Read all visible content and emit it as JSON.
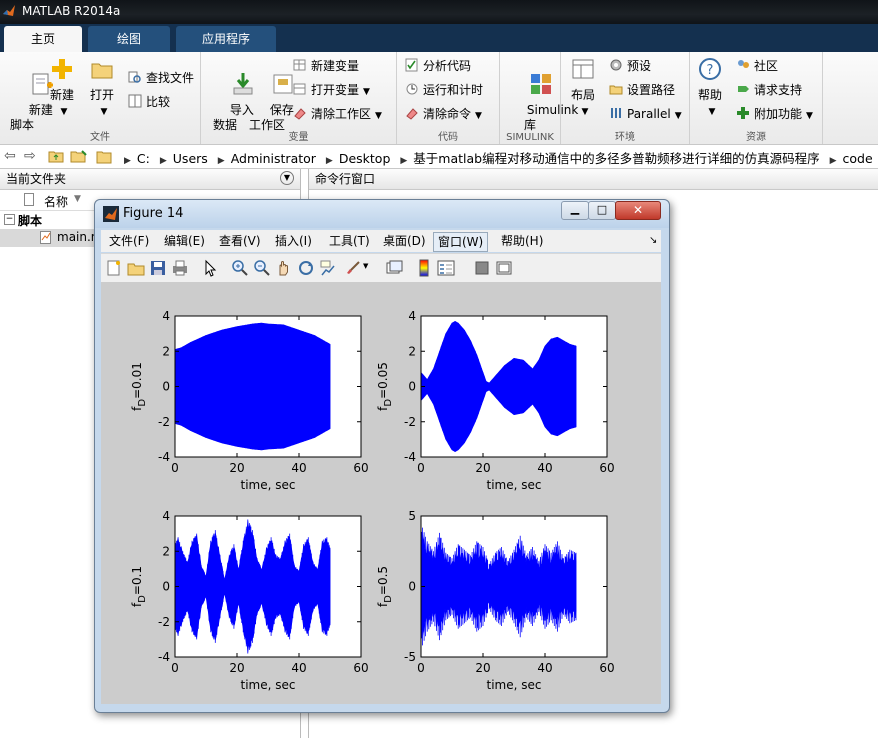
{
  "window": {
    "title": "MATLAB R2014a"
  },
  "ribbon_tabs": [
    {
      "label": "主页",
      "active": true
    },
    {
      "label": "绘图",
      "active": false
    },
    {
      "label": "应用程序",
      "active": false
    }
  ],
  "ribbon": {
    "file": {
      "new_script": "新建\n脚本",
      "new": "新建",
      "open": "打开",
      "find_files": "查找文件",
      "compare": "比较",
      "label": "文件"
    },
    "variable": {
      "import": "导入\n数据",
      "save_ws": "保存\n工作区",
      "new_var": "新建变量",
      "open_var": "打开变量",
      "clear_ws": "清除工作区",
      "label": "变量"
    },
    "code": {
      "analyze": "分析代码",
      "run_time": "运行和计时",
      "clear_cmds": "清除命令",
      "label": "代码"
    },
    "simulink": {
      "lib": "Simulink\n库",
      "label": "SIMULINK"
    },
    "env": {
      "layout": "布局",
      "prefs": "预设",
      "set_path": "设置路径",
      "parallel": "Parallel",
      "label": "环境"
    },
    "resources": {
      "help": "帮助",
      "community": "社区",
      "support": "请求支持",
      "addons": "附加功能",
      "label": "资源"
    }
  },
  "address": {
    "path": [
      "C:",
      "Users",
      "Administrator",
      "Desktop",
      "基于matlab编程对移动通信中的多径多普勒频移进行详细的仿真源码程序",
      "code"
    ]
  },
  "current_folder": {
    "title": "当前文件夹",
    "column": "名称",
    "group": "脚本",
    "file": "main.m"
  },
  "command_window": {
    "title": "命令行窗口"
  },
  "figure": {
    "title": "Figure 14",
    "menu": [
      "文件(F)",
      "编辑(E)",
      "查看(V)",
      "插入(I)",
      "工具(T)",
      "桌面(D)",
      "窗口(W)",
      "帮助(H)"
    ],
    "toolbar_icons": [
      "new-figure-icon",
      "open-file-icon",
      "save-icon",
      "print-icon",
      "select-arrow-icon",
      "zoom-in-icon",
      "zoom-out-icon",
      "pan-hand-icon",
      "rotate-icon",
      "data-cursor-icon",
      "brush-icon",
      "link-plot-icon",
      "colorbar-icon",
      "legend-icon",
      "hide-tools-icon",
      "show-tools-icon"
    ]
  },
  "colors": {
    "signal": "#0000ff",
    "ribbon_blue": "#14304f"
  },
  "chart_data": [
    {
      "type": "area",
      "title": "",
      "xlabel": "time, sec",
      "ylabel": "f_D=0.01",
      "xlim": [
        0,
        60
      ],
      "ylim": [
        -4,
        4
      ],
      "xticks": [
        "0",
        "20",
        "40",
        "60"
      ],
      "yticks": [
        "4",
        "2",
        "0",
        "-2",
        "-4"
      ],
      "series": [
        {
          "x": [
            0,
            2,
            5,
            10,
            15,
            20,
            25,
            28,
            30,
            35,
            40,
            45,
            48,
            50
          ],
          "upper": [
            2.1,
            2.2,
            2.5,
            2.9,
            3.2,
            3.4,
            3.55,
            3.6,
            3.55,
            3.5,
            3.2,
            2.9,
            2.6,
            2.4
          ]
        }
      ]
    },
    {
      "type": "area",
      "title": "",
      "xlabel": "time, sec",
      "ylabel": "f_D=0.05",
      "xlim": [
        0,
        60
      ],
      "ylim": [
        -4,
        4
      ],
      "xticks": [
        "0",
        "20",
        "40",
        "60"
      ],
      "yticks": [
        "4",
        "2",
        "0",
        "-2",
        "-4"
      ],
      "series": [
        {
          "x": [
            0,
            2,
            4,
            6,
            8,
            10,
            11,
            12,
            14,
            16,
            18,
            20,
            21,
            22,
            24,
            27,
            30,
            33,
            36,
            38,
            40,
            42,
            44,
            46,
            48,
            50
          ],
          "upper": [
            0.8,
            0.4,
            1.0,
            2.0,
            3.0,
            3.6,
            3.7,
            3.6,
            3.2,
            2.6,
            1.8,
            0.8,
            0.3,
            0.2,
            0.6,
            1.2,
            1.6,
            1.5,
            1.0,
            1.5,
            2.3,
            2.7,
            2.8,
            2.6,
            2.4,
            2.3
          ]
        }
      ]
    },
    {
      "type": "area",
      "title": "",
      "xlabel": "time, sec",
      "ylabel": "f_D=0.1",
      "xlim": [
        0,
        60
      ],
      "ylim": [
        -4,
        4
      ],
      "xticks": [
        "0",
        "20",
        "40",
        "60"
      ],
      "yticks": [
        "4",
        "2",
        "0",
        "-2",
        "-4"
      ],
      "series": [
        {
          "x": [
            0,
            1,
            2.5,
            4,
            5.5,
            7,
            8.5,
            10,
            11.5,
            13,
            14.5,
            16,
            17.5,
            19,
            20.5,
            22,
            23.5,
            25,
            26.5,
            28,
            29.5,
            31,
            32.5,
            34,
            35.5,
            37,
            38.5,
            40,
            41.5,
            43,
            44.5,
            46,
            47.5,
            49,
            50
          ],
          "upper": [
            2.4,
            2.8,
            2.0,
            1.4,
            2.6,
            3.0,
            1.2,
            0.6,
            2.6,
            3.2,
            1.8,
            0.4,
            1.8,
            2.4,
            1.0,
            2.6,
            3.8,
            3.2,
            1.6,
            1.0,
            2.2,
            2.8,
            1.8,
            1.6,
            2.6,
            3.0,
            1.2,
            0.9,
            2.4,
            2.8,
            1.4,
            1.0,
            2.6,
            2.8,
            2.2
          ]
        }
      ]
    },
    {
      "type": "area",
      "title": "",
      "xlabel": "time, sec",
      "ylabel": "f_D=0.5",
      "xlim": [
        0,
        60
      ],
      "ylim": [
        -5,
        5
      ],
      "xticks": [
        "0",
        "20",
        "40",
        "60"
      ],
      "yticks": [
        "5",
        "0",
        "-5"
      ],
      "series": [
        {
          "x": [
            0,
            2,
            4,
            6,
            8,
            10,
            12,
            14,
            16,
            18,
            20,
            22,
            24,
            26,
            28,
            30,
            32,
            34,
            36,
            38,
            40,
            42,
            44,
            46,
            48,
            50
          ],
          "upper": [
            4.5,
            3.2,
            2.5,
            3.8,
            2.4,
            2.0,
            3.0,
            2.6,
            2.2,
            3.2,
            2.8,
            1.6,
            2.4,
            2.8,
            1.8,
            2.6,
            3.6,
            2.2,
            2.8,
            1.8,
            3.0,
            2.4,
            3.2,
            2.0,
            2.6,
            2.4
          ]
        }
      ]
    }
  ]
}
